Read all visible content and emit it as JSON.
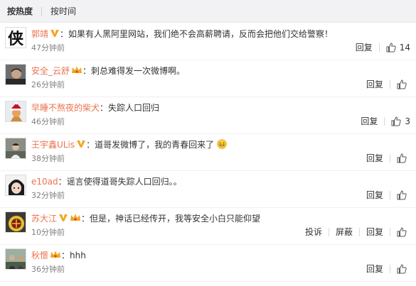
{
  "sort": {
    "hot": "按热度",
    "time": "按时间"
  },
  "actions": {
    "reply": "回复",
    "report": "投诉",
    "block": "屏蔽"
  },
  "comments": [
    {
      "user": "郭靖",
      "text": "：如果有人黑阿里网站，我们绝不会高薪聘请，反而会把他们交给警察！",
      "time": "47分钟前",
      "likes": "14",
      "avatar_text": "侠"
    },
    {
      "user": "安全_云舒",
      "text": "：刺总难得发一次微博啊。",
      "time": "26分钟前",
      "likes": ""
    },
    {
      "user": "早睡不熬夜的柴犬",
      "text": "：失踪人口回归",
      "time": "46分钟前",
      "likes": "3"
    },
    {
      "user": "王宇鑫ULis",
      "text": "：道哥发微博了，我的青春回来了",
      "time": "38分钟前",
      "likes": ""
    },
    {
      "user": "e10ad",
      "text": "：谣言使得道哥失踪人口回归。。",
      "time": "32分钟前",
      "likes": ""
    },
    {
      "user": "苏大江",
      "text": "：但是，神话已经传开，我等安全小白只能仰望",
      "time": "10分钟前",
      "likes": ""
    },
    {
      "user": "秋憬",
      "text": "：hhh",
      "time": "36分钟前",
      "likes": ""
    }
  ],
  "colors": {
    "username": "#eb7350",
    "verified": "#f5a623",
    "meta": "#808080"
  }
}
